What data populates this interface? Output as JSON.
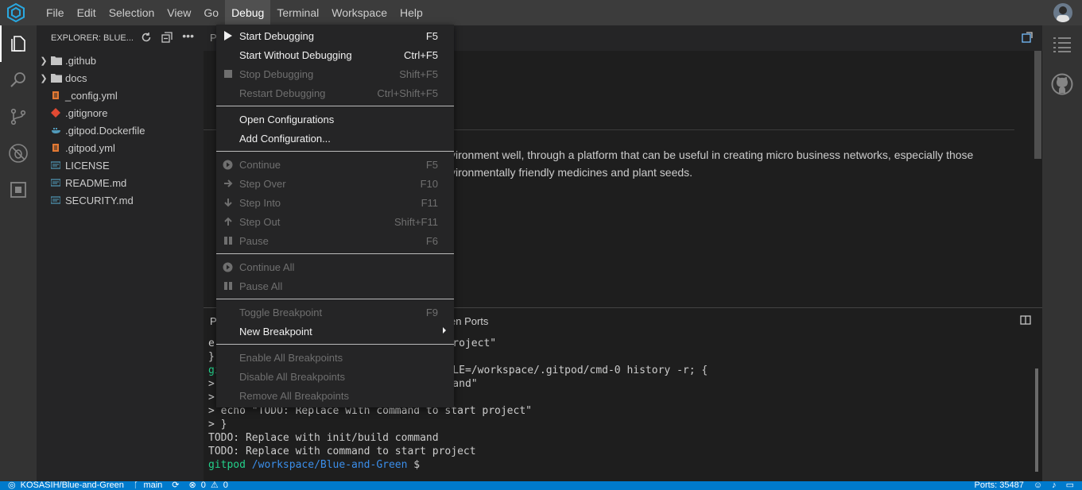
{
  "menubar": {
    "items": [
      "File",
      "Edit",
      "Selection",
      "View",
      "Go",
      "Debug",
      "Terminal",
      "Workspace",
      "Help"
    ],
    "active": "Debug"
  },
  "explorer": {
    "title": "EXPLORER: BLUE...",
    "items": [
      {
        "label": ".github",
        "type": "folder"
      },
      {
        "label": "docs",
        "type": "folder"
      },
      {
        "label": "_config.yml",
        "type": "yml"
      },
      {
        "label": ".gitignore",
        "type": "git"
      },
      {
        "label": ".gitpod.Dockerfile",
        "type": "docker"
      },
      {
        "label": ".gitpod.yml",
        "type": "yml"
      },
      {
        "label": "LICENSE",
        "type": "text"
      },
      {
        "label": "README.md",
        "type": "text"
      },
      {
        "label": "SECURITY.md",
        "type": "text"
      }
    ]
  },
  "editor": {
    "tab_letter": "P",
    "line1": "vironment well, through a platform that can be useful in creating micro business networks, especially those",
    "line2": "vironmentally friendly medicines and plant seeds."
  },
  "panel": {
    "tab_letter": "P",
    "open_ports_label": "en Ports"
  },
  "terminal": {
    "lines": [
      {
        "text": "e",
        "rest": "rt project\""
      },
      {
        "text": "}"
      },
      {
        "text": "gi",
        "rest": "STFILE=/workspace/.gitpod/cmd-0 history -r; {"
      },
      {
        "text": ">",
        "rest": "command\""
      },
      {
        "text": ">"
      },
      {
        "text": "> echo \"TODO: Replace with command to start project\""
      },
      {
        "text": "> }"
      },
      {
        "text": "TODO: Replace with init/build command"
      },
      {
        "text": "TODO: Replace with command to start project"
      }
    ],
    "prompt_user": "gitpod",
    "prompt_path": "/workspace/Blue-and-Green",
    "prompt_symbol": "$"
  },
  "debug_menu": {
    "groups": [
      [
        {
          "label": "Start Debugging",
          "key": "F5",
          "enabled": true,
          "icon": "play-icon"
        },
        {
          "label": "Start Without Debugging",
          "key": "Ctrl+F5",
          "enabled": true,
          "icon": ""
        },
        {
          "label": "Stop Debugging",
          "key": "Shift+F5",
          "enabled": false,
          "icon": "stop-icon"
        },
        {
          "label": "Restart Debugging",
          "key": "Ctrl+Shift+F5",
          "enabled": false,
          "icon": ""
        }
      ],
      [
        {
          "label": "Open Configurations",
          "key": "",
          "enabled": true,
          "icon": ""
        },
        {
          "label": "Add Configuration...",
          "key": "",
          "enabled": true,
          "icon": ""
        }
      ],
      [
        {
          "label": "Continue",
          "key": "F5",
          "enabled": false,
          "icon": "continue-icon"
        },
        {
          "label": "Step Over",
          "key": "F10",
          "enabled": false,
          "icon": "step-over-icon"
        },
        {
          "label": "Step Into",
          "key": "F11",
          "enabled": false,
          "icon": "step-into-icon"
        },
        {
          "label": "Step Out",
          "key": "Shift+F11",
          "enabled": false,
          "icon": "step-out-icon"
        },
        {
          "label": "Pause",
          "key": "F6",
          "enabled": false,
          "icon": "pause-icon"
        }
      ],
      [
        {
          "label": "Continue All",
          "key": "",
          "enabled": false,
          "icon": "continue-icon"
        },
        {
          "label": "Pause All",
          "key": "",
          "enabled": false,
          "icon": "pause-icon"
        }
      ],
      [
        {
          "label": "Toggle Breakpoint",
          "key": "F9",
          "enabled": false,
          "icon": ""
        },
        {
          "label": "New Breakpoint",
          "key": "",
          "enabled": true,
          "icon": "",
          "submenu": true
        }
      ],
      [
        {
          "label": "Enable All Breakpoints",
          "key": "",
          "enabled": false,
          "icon": ""
        },
        {
          "label": "Disable All Breakpoints",
          "key": "",
          "enabled": false,
          "icon": ""
        },
        {
          "label": "Remove All Breakpoints",
          "key": "",
          "enabled": false,
          "icon": ""
        }
      ]
    ]
  },
  "statusbar": {
    "repo": "KOSASIH/Blue-and-Green",
    "branch": "main",
    "errors": "0",
    "warnings": "0",
    "ports": "Ports: 35487"
  }
}
